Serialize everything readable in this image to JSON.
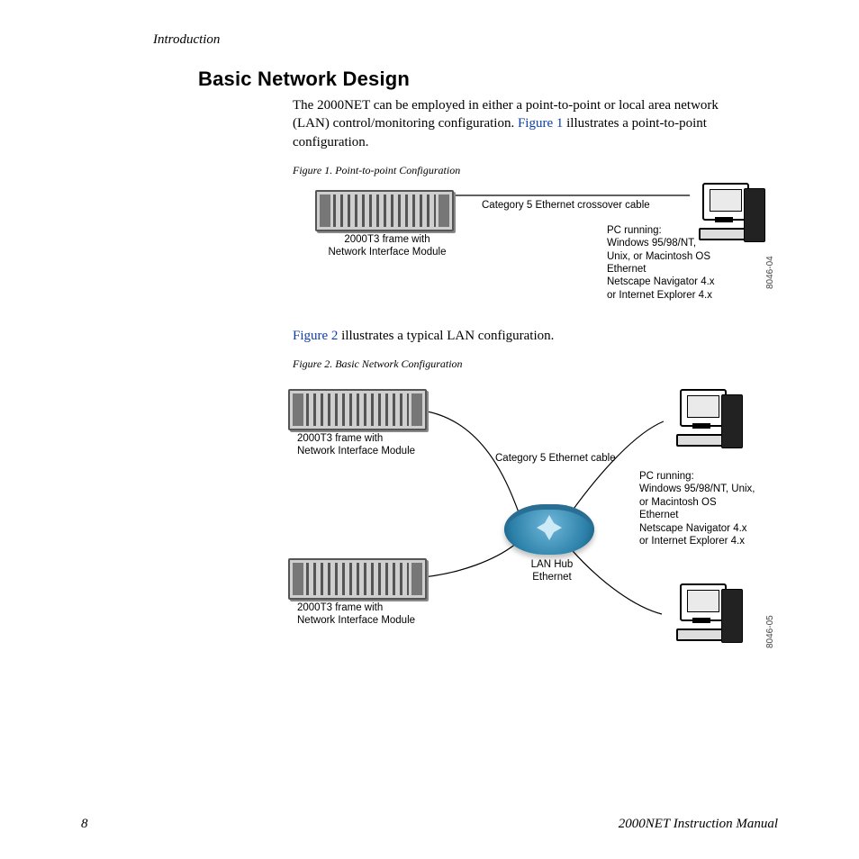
{
  "header": {
    "section": "Introduction"
  },
  "title": "Basic Network Design",
  "para1": {
    "t1": "The 2000NET can be employed in either a point-to-point or local area network (LAN) control/monitoring configuration. ",
    "link": "Figure 1",
    "t2": " illustrates a point-to-point configuration."
  },
  "para2": {
    "link": "Figure 2",
    "t2": " illustrates a typical LAN configuration."
  },
  "fig1": {
    "caption": "Figure 1.  Point-to-point Configuration",
    "rack_label_l1": "2000T3  frame with",
    "rack_label_l2": "Network Interface Module",
    "cable_label": "Category 5 Ethernet crossover cable",
    "pc_l1": "PC running:",
    "pc_l2": "Windows 95/98/NT,",
    "pc_l3": "Unix, or Macintosh OS",
    "pc_l4": "Ethernet",
    "pc_l5": "Netscape Navigator 4.x",
    "pc_l6": "or Internet Explorer 4.x",
    "code": "8046-04"
  },
  "fig2": {
    "caption": "Figure 2.  Basic Network Configuration",
    "rack_label_l1": "2000T3 frame with",
    "rack_label_l2": "Network Interface Module",
    "cable_label": "Category 5 Ethernet cable",
    "hub_l1": "LAN Hub",
    "hub_l2": "Ethernet",
    "pc_l1": "PC running:",
    "pc_l2": "Windows 95/98/NT, Unix,",
    "pc_l3": "   or Macintosh OS",
    "pc_l4": "Ethernet",
    "pc_l5": "Netscape Navigator 4.x",
    "pc_l6": "or Internet Explorer 4.x",
    "code": "8046-05"
  },
  "footer": {
    "page": "8",
    "doc": "2000NET Instruction Manual"
  }
}
